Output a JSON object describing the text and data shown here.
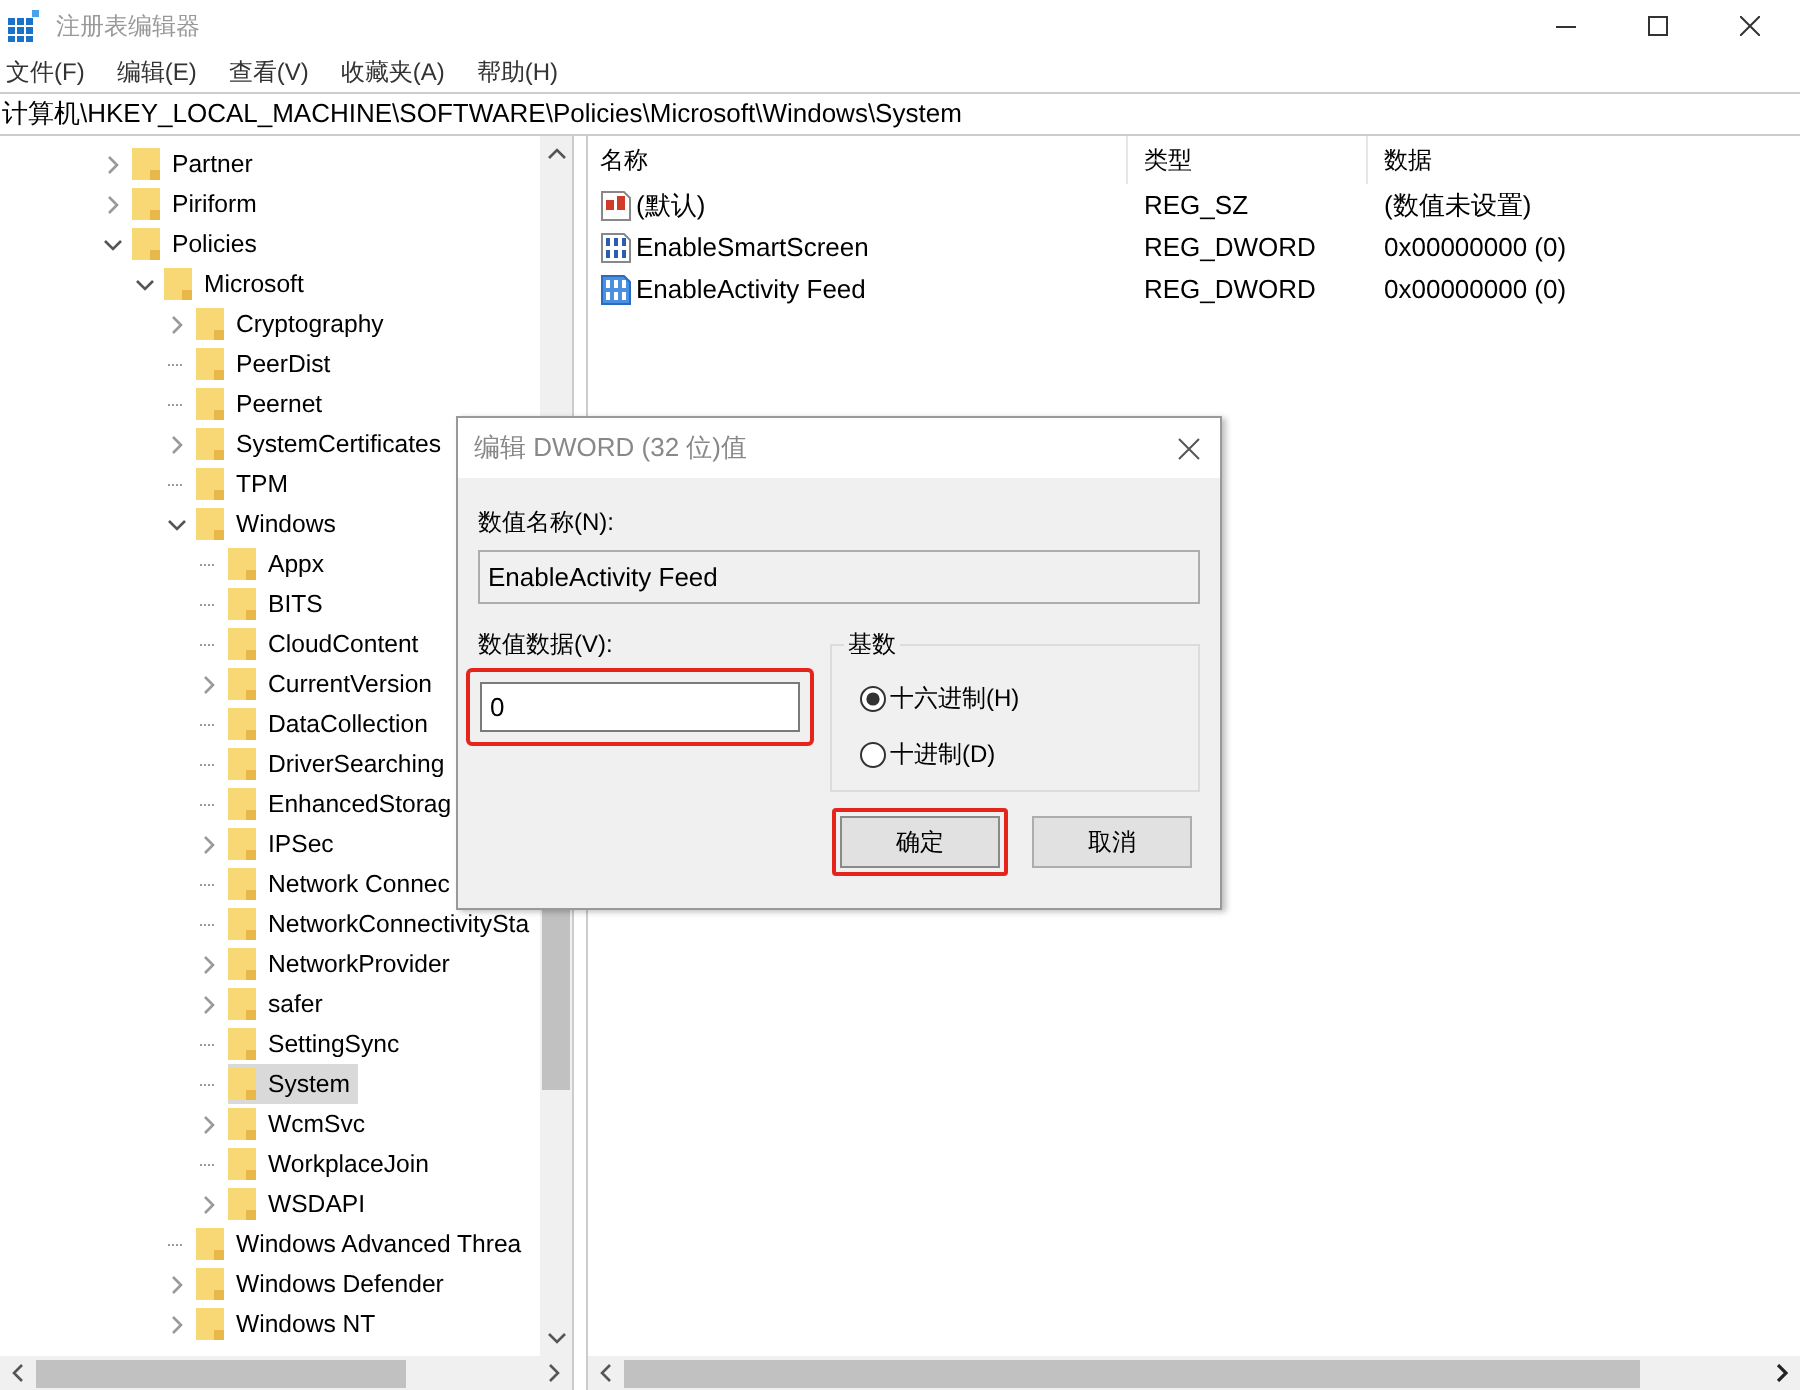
{
  "window": {
    "title": "注册表编辑器"
  },
  "menu": [
    "文件(F)",
    "编辑(E)",
    "查看(V)",
    "收藏夹(A)",
    "帮助(H)"
  ],
  "address": "计算机\\HKEY_LOCAL_MACHINE\\SOFTWARE\\Policies\\Microsoft\\Windows\\System",
  "tree": [
    {
      "label": "Partner",
      "expanded": false,
      "selected": false
    },
    {
      "label": "Piriform",
      "expanded": false,
      "selected": false
    },
    {
      "label": "Policies",
      "expanded": true,
      "selected": false,
      "children": [
        {
          "label": "Microsoft",
          "expanded": true,
          "selected": false,
          "children": [
            {
              "label": "Cryptography",
              "expanded": false,
              "selected": false
            },
            {
              "label": "PeerDist",
              "selected": false
            },
            {
              "label": "Peernet",
              "selected": false
            },
            {
              "label": "SystemCertificates",
              "expanded": false,
              "selected": false
            },
            {
              "label": "TPM",
              "selected": false
            },
            {
              "label": "Windows",
              "expanded": true,
              "selected": false,
              "children": [
                {
                  "label": "Appx",
                  "selected": false
                },
                {
                  "label": "BITS",
                  "selected": false
                },
                {
                  "label": "CloudContent",
                  "selected": false
                },
                {
                  "label": "CurrentVersion",
                  "expanded": false,
                  "selected": false
                },
                {
                  "label": "DataCollection",
                  "selected": false
                },
                {
                  "label": "DriverSearching",
                  "selected": false
                },
                {
                  "label": "EnhancedStorag",
                  "selected": false
                },
                {
                  "label": "IPSec",
                  "expanded": false,
                  "selected": false
                },
                {
                  "label": "Network Connec",
                  "selected": false
                },
                {
                  "label": "NetworkConnectivitySta",
                  "selected": false
                },
                {
                  "label": "NetworkProvider",
                  "expanded": false,
                  "selected": false
                },
                {
                  "label": "safer",
                  "expanded": false,
                  "selected": false
                },
                {
                  "label": "SettingSync",
                  "selected": false
                },
                {
                  "label": "System",
                  "selected": true
                },
                {
                  "label": "WcmSvc",
                  "expanded": false,
                  "selected": false
                },
                {
                  "label": "WorkplaceJoin",
                  "selected": false
                },
                {
                  "label": "WSDAPI",
                  "expanded": false,
                  "selected": false
                }
              ]
            },
            {
              "label": "Windows Advanced Threa",
              "selected": false
            },
            {
              "label": "Windows Defender",
              "expanded": false,
              "selected": false
            },
            {
              "label": "Windows NT",
              "expanded": false,
              "selected": false
            }
          ]
        }
      ]
    }
  ],
  "values": {
    "columns": [
      "名称",
      "类型",
      "数据"
    ],
    "rows": [
      {
        "kind": "string",
        "name": "(默认)",
        "type": "REG_SZ",
        "data": "(数值未设置)",
        "selected": false
      },
      {
        "kind": "dword",
        "name": "EnableSmartScreen",
        "type": "REG_DWORD",
        "data": "0x00000000 (0)",
        "selected": false
      },
      {
        "kind": "dword",
        "name": "EnableActivity Feed",
        "type": "REG_DWORD",
        "data": "0x00000000 (0)",
        "selected": true
      }
    ]
  },
  "dialog": {
    "title": "编辑 DWORD (32 位)值",
    "name_label": "数值名称(N):",
    "name_value": "EnableActivity Feed",
    "data_label": "数值数据(V):",
    "data_value": "0",
    "data_highlighted": true,
    "base_label": "基数",
    "base_options": [
      {
        "label": "十六进制(H)",
        "selected": true
      },
      {
        "label": "十进制(D)",
        "selected": false
      }
    ],
    "buttons": [
      {
        "label": "确定",
        "highlighted": true
      },
      {
        "label": "取消",
        "highlighted": false
      }
    ]
  }
}
